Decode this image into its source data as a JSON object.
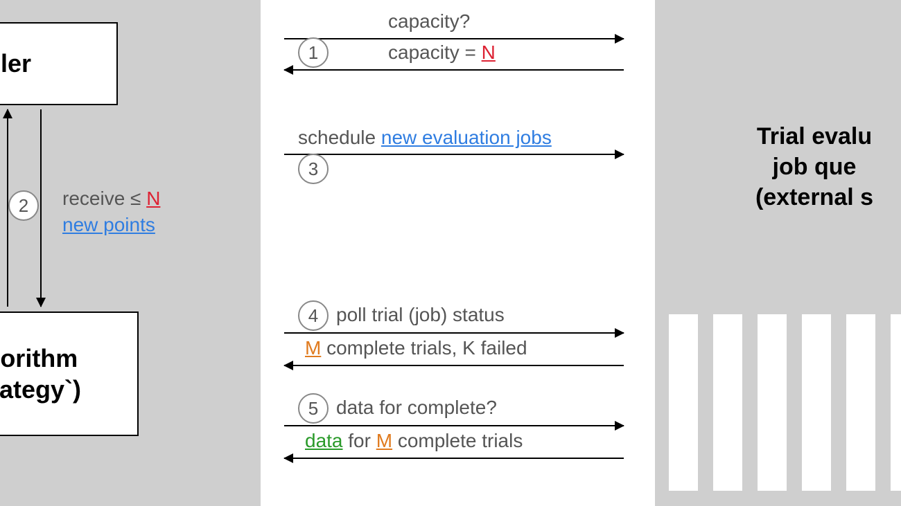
{
  "left_panel": {
    "scheduler_box": "heduler",
    "algo_line1": "tion Algorithm",
    "algo_line2": "ationStrategy`)"
  },
  "right_panel": {
    "title_line1": "Trial evalu",
    "title_line2": "job que",
    "title_line3": "(external s"
  },
  "steps": {
    "s1": {
      "num": "1",
      "top_label": "capacity?",
      "bottom_prefix": "capacity = ",
      "bottom_N": "N"
    },
    "s2": {
      "num": "2",
      "recv_prefix": "receive ≤ ",
      "recv_N": "N",
      "recv_link": "new points"
    },
    "s3": {
      "num": "3",
      "prefix": "schedule ",
      "link": "new evaluation jobs"
    },
    "s4": {
      "num": "4",
      "top": "poll trial (job) status",
      "bot_M": "M",
      "bot_mid": " complete trials, K failed"
    },
    "s5": {
      "num": "5",
      "top": "data for complete?",
      "bot_data": "data",
      "bot_mid": " for ",
      "bot_M": "M",
      "bot_end": " complete trials"
    }
  }
}
